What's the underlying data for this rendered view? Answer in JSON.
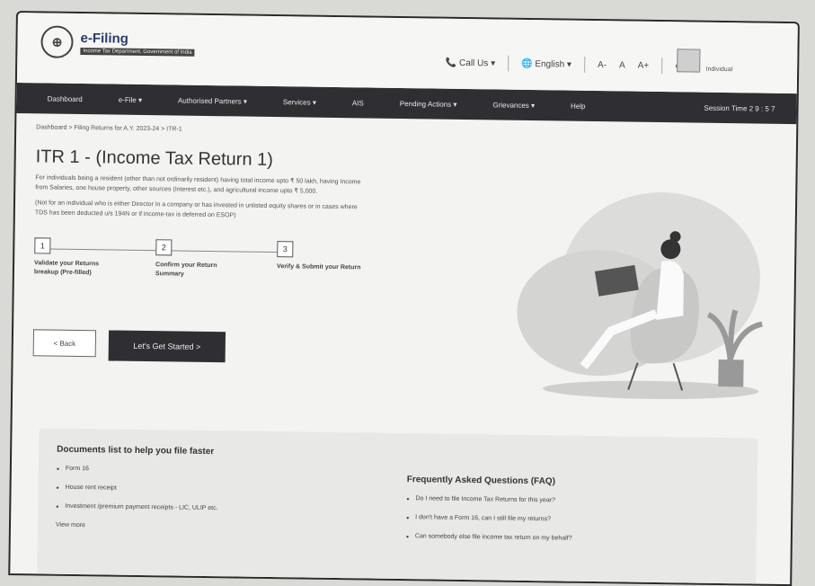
{
  "header": {
    "logo_text": "e-Filing",
    "logo_sub": "Income Tax Department, Government of India",
    "emblem_glyph": "⊕",
    "call_us": "Call Us",
    "language": "English",
    "font_small": "A-",
    "font_reset": "A",
    "font_large": "A+",
    "contrast": "◐",
    "user_label": "Individual"
  },
  "nav": {
    "items": [
      "Dashboard",
      "e-File ▾",
      "Authorised Partners ▾",
      "Services ▾",
      "AIS",
      "Pending Actions ▾",
      "Grievances ▾",
      "Help"
    ],
    "session": "Session Time  2 9 : 5 7"
  },
  "breadcrumb": "Dashboard > Filing Returns for A.Y. 2023-24 > ITR-1",
  "page": {
    "title": "ITR 1 - (Income Tax Return 1)",
    "desc1": "For individuals being a resident (other than not ordinarily resident) having total income upto ₹ 50 lakh, having Income from Salaries, one house property, other sources (Interest etc.), and agricultural income upto ₹ 5,000.",
    "desc2": "(Not for an individual who is either Director in a company or has invested in unlisted equity shares or in cases where TDS has been deducted u/s 194N or if income-tax is deferred on ESOP)"
  },
  "steps": [
    {
      "num": "1",
      "label": "Validate your Returns breakup (Pre-filled)"
    },
    {
      "num": "2",
      "label": "Confirm your Return Summary"
    },
    {
      "num": "3",
      "label": "Verify & Submit your Return"
    }
  ],
  "buttons": {
    "back": "< Back",
    "start": "Let's Get Started >"
  },
  "documents": {
    "title": "Documents list to help you file faster",
    "items": [
      "Form 16",
      "House rent receipt",
      "Investment /premium payment receipts - LIC, ULIP etc."
    ],
    "view_more": "View more"
  },
  "faq": {
    "title": "Frequently Asked Questions (FAQ)",
    "items": [
      "Do I need to file Income Tax Returns for this year?",
      "I don't have a Form 16, can I still file my returns?",
      "Can somebody else file income tax return on my behalf?"
    ]
  },
  "colors": {
    "nav_bg": "#2f2f33",
    "button_dark": "#2f2f33",
    "page_bg": "#f3f3f1"
  }
}
